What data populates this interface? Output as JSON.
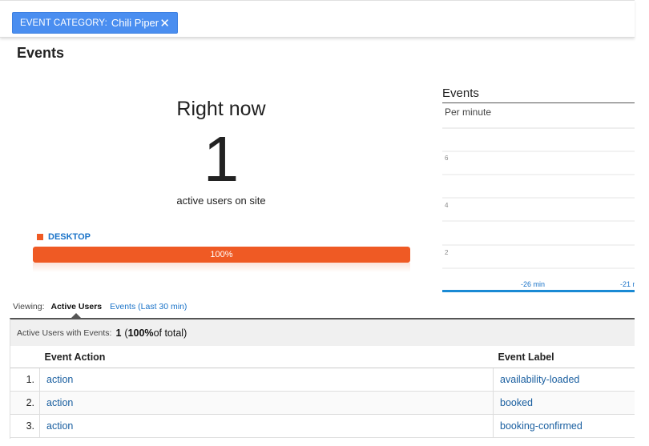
{
  "filter": {
    "key": "EVENT CATEGORY:",
    "value": "Chili Piper",
    "close_glyph": "✕"
  },
  "page_title": "Events",
  "right_now": {
    "heading": "Right now",
    "count": "1",
    "label": "active users on site"
  },
  "device": {
    "label": "DESKTOP",
    "percent_text": "100%",
    "fill_fraction": 1.0,
    "color": "#ef5a24"
  },
  "chart": {
    "title": "Events",
    "subtitle": "Per minute",
    "y_ticks": [
      "6",
      "4",
      "2"
    ],
    "x_ticks": [
      "-26 min",
      "-21 m"
    ]
  },
  "viewing": {
    "label": "Viewing:",
    "active_tab": "Active Users",
    "other_tab": "Events (Last 30 min)"
  },
  "summary": {
    "label": "Active Users with Events:",
    "count": "1",
    "pct_open": "(",
    "pct": "100%",
    "pct_rest": " of total)"
  },
  "table": {
    "headers": {
      "action": "Event Action",
      "label": "Event Label"
    },
    "rows": [
      {
        "idx": "1.",
        "action": "action",
        "label": "availability-loaded"
      },
      {
        "idx": "2.",
        "action": "action",
        "label": "booked"
      },
      {
        "idx": "3.",
        "action": "action",
        "label": "booking-confirmed"
      }
    ]
  },
  "colors": {
    "accent": "#4a8ef0",
    "bar": "#ef5a24",
    "link": "#1a73c8",
    "chart_axis": "#1a8ad4"
  }
}
